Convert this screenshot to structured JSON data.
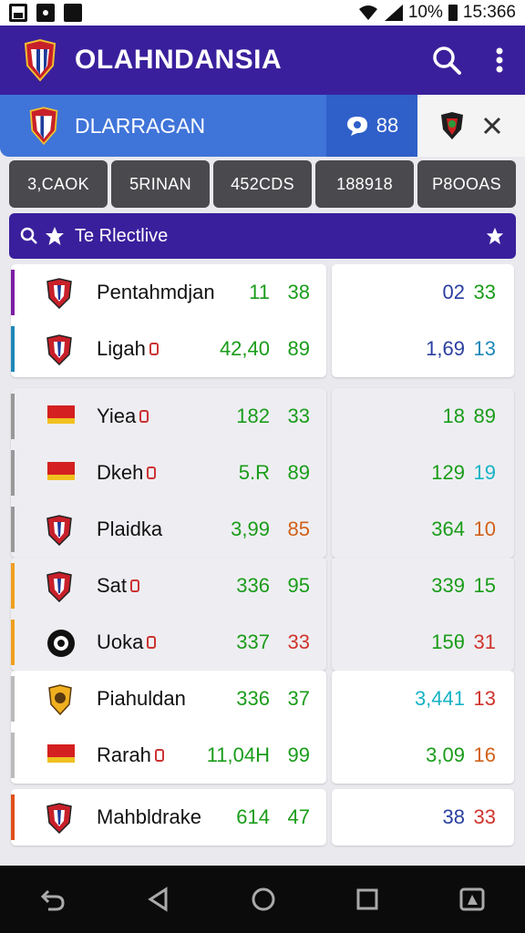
{
  "status_bar": {
    "battery": "10%",
    "time": "15:366"
  },
  "app_bar": {
    "title": "OLAHNDANSIA",
    "icons": [
      "club-crest-icon",
      "search-icon",
      "more-vert-icon"
    ]
  },
  "team_header": {
    "name": "DLARRAGAN",
    "count": "88",
    "icons": [
      "chat-bubble-icon",
      "club-crest-icon",
      "close-icon"
    ]
  },
  "filters": [
    "3,CAOK",
    "5RINAN",
    "452CDS",
    "188918",
    "P8OOAS"
  ],
  "search": {
    "text": "Te Rlectlive"
  },
  "rows": [
    {
      "player": "Pentahmdjan",
      "v1": "11",
      "v2": "38",
      "v3": "02",
      "v4": "33",
      "c1": "#1a9c1a",
      "c2": "#1a9c1a",
      "c3": "#2a3fa0",
      "c4": "#1a9c1a",
      "badge": "shield-icon",
      "mini": false
    },
    {
      "player": "Ligah",
      "v1": "42,40",
      "v2": "89",
      "v3": "1,69",
      "v4": "13",
      "c1": "#1a9c1a",
      "c2": "#1a9c1a",
      "c3": "#2a3fa0",
      "c4": "#1e88b8",
      "badge": "shield-icon",
      "mini": true
    },
    {
      "player": "Yiea",
      "v1": "182",
      "v2": "33",
      "v3": "18",
      "v4": "89",
      "c1": "#1a9c1a",
      "c2": "#1a9c1a",
      "c3": "#1a9c1a",
      "c4": "#1a9c1a",
      "badge": "flag-icon",
      "mini": true
    },
    {
      "player": "Dkeh",
      "v1": "5.R",
      "v2": "89",
      "v3": "129",
      "v4": "19",
      "c1": "#1a9c1a",
      "c2": "#1a9c1a",
      "c3": "#1a9c1a",
      "c4": "#16b3c4",
      "badge": "flag-icon",
      "mini": true
    },
    {
      "player": "Plaidka",
      "v1": "3,99",
      "v2": "85",
      "v3": "364",
      "v4": "10",
      "c1": "#1a9c1a",
      "c2": "#d2601a",
      "c3": "#1a9c1a",
      "c4": "#d2601a",
      "badge": "shield-icon",
      "mini": false
    },
    {
      "player": "Sat",
      "v1": "336",
      "v2": "95",
      "v3": "339",
      "v4": "15",
      "c1": "#1a9c1a",
      "c2": "#1a9c1a",
      "c3": "#1a9c1a",
      "c4": "#1a9c1a",
      "badge": "shield-icon",
      "mini": true
    },
    {
      "player": "Uoka",
      "v1": "337",
      "v2": "33",
      "v3": "15θ",
      "v4": "31",
      "c1": "#1a9c1a",
      "c2": "#d0342c",
      "c3": "#1a9c1a",
      "c4": "#d0342c",
      "badge": "ball-icon",
      "mini": true
    },
    {
      "player": "Piahuldan",
      "v1": "336",
      "v2": "37",
      "v3": "3,441",
      "v4": "13",
      "c1": "#1a9c1a",
      "c2": "#1a9c1a",
      "c3": "#16b3c4",
      "c4": "#d0342c",
      "badge": "lion-crest-icon",
      "mini": false
    },
    {
      "player": "Rarah",
      "v1": "11,04H",
      "v2": "99",
      "v3": "3,09",
      "v4": "16",
      "c1": "#1a9c1a",
      "c2": "#1a9c1a",
      "c3": "#1a9c1a",
      "c4": "#d2601a",
      "badge": "flag-icon",
      "mini": true
    },
    {
      "player": "Mahbldrake",
      "v1": "614",
      "v2": "47",
      "v3": "38",
      "v4": "33",
      "c1": "#1a9c1a",
      "c2": "#1a9c1a",
      "c3": "#2a3fa0",
      "c4": "#d0342c",
      "badge": "shield-icon",
      "mini": false
    }
  ],
  "nav_bar": {
    "icons": [
      "back-icon",
      "triangle-back-icon",
      "home-icon",
      "recents-icon",
      "screenshot-icon"
    ]
  }
}
